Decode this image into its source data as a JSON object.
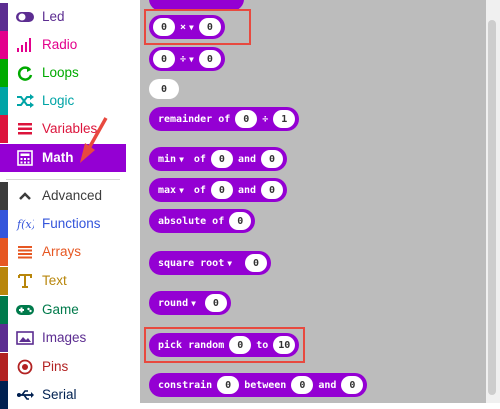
{
  "toolbox": {
    "categories": [
      {
        "label": "Led",
        "color": "#5C2D91",
        "icon": "toggle-icon"
      },
      {
        "label": "Radio",
        "color": "#E3008C",
        "icon": "signal-bars-icon"
      },
      {
        "label": "Loops",
        "color": "#00AA00",
        "icon": "loop-icon"
      },
      {
        "label": "Logic",
        "color": "#00A4A6",
        "icon": "shuffle-icon"
      },
      {
        "label": "Variables",
        "color": "#DC143C",
        "icon": "list-icon"
      },
      {
        "label": "Math",
        "color": "#9400D3",
        "icon": "calculator-icon"
      },
      {
        "label": "Advanced",
        "color": "#3C3C3C",
        "icon": "chevron-up-icon"
      },
      {
        "label": "Functions",
        "color": "#3455DB",
        "icon": "function-icon"
      },
      {
        "label": "Arrays",
        "color": "#E65722",
        "icon": "arrays-icon"
      },
      {
        "label": "Text",
        "color": "#B8860B",
        "icon": "text-icon"
      },
      {
        "label": "Game",
        "color": "#007A4B",
        "icon": "gamepad-icon"
      },
      {
        "label": "Images",
        "color": "#5C2D91",
        "icon": "image-icon"
      },
      {
        "label": "Pins",
        "color": "#B22222",
        "icon": "target-icon"
      },
      {
        "label": "Serial",
        "color": "#002050",
        "icon": "usb-icon"
      }
    ],
    "selected": "Math"
  },
  "flyout": {
    "background": "#bcbcbc",
    "block_color": "#9400D3",
    "highlight_color": "#e8493f",
    "multiply": {
      "left": "0",
      "op": "×",
      "right": "0"
    },
    "divide": {
      "left": "0",
      "op": "÷",
      "right": "0"
    },
    "number": {
      "value": "0"
    },
    "remainder": {
      "label": "remainder of",
      "left": "0",
      "op": "÷",
      "right": "1"
    },
    "min": {
      "label": "min",
      "of": "of",
      "left": "0",
      "and": "and",
      "right": "0"
    },
    "max": {
      "label": "max",
      "of": "of",
      "left": "0",
      "and": "and",
      "right": "0"
    },
    "absolute": {
      "label": "absolute of",
      "value": "0"
    },
    "square_root": {
      "label": "square root",
      "value": "0"
    },
    "round": {
      "label": "round",
      "value": "0"
    },
    "pick_random": {
      "label": "pick random",
      "from": "0",
      "to_label": "to",
      "to": "10"
    },
    "constrain": {
      "label": "constrain",
      "value": "0",
      "between": "between",
      "low": "0",
      "and": "and",
      "high": "0"
    }
  }
}
